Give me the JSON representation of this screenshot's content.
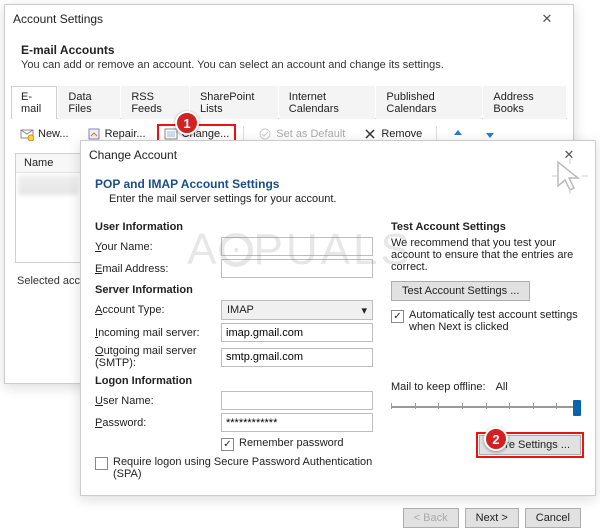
{
  "win1": {
    "title": "Account Settings",
    "header_title": "E-mail Accounts",
    "header_sub": "You can add or remove an account. You can select an account and change its settings.",
    "tabs": [
      "E-mail",
      "Data Files",
      "RSS Feeds",
      "SharePoint Lists",
      "Internet Calendars",
      "Published Calendars",
      "Address Books"
    ],
    "toolbar": {
      "new": "New...",
      "repair": "Repair...",
      "change": "Change...",
      "setdefault": "Set as Default",
      "remove": "Remove"
    },
    "list_header": "Name",
    "selected_label": "Selected account de"
  },
  "win2": {
    "title": "Change Account",
    "section_title": "POP and IMAP Account Settings",
    "section_sub": "Enter the mail server settings for your account.",
    "groups": {
      "user": "User Information",
      "server": "Server Information",
      "logon": "Logon Information"
    },
    "labels": {
      "yourname": "Your Name:",
      "email": "Email Address:",
      "accttype": "Account Type:",
      "incoming": "Incoming mail server:",
      "outgoing": "Outgoing mail server (SMTP):",
      "username": "User Name:",
      "password": "Password:"
    },
    "values": {
      "yourname": "",
      "email": "",
      "accttype": "IMAP",
      "incoming": "imap.gmail.com",
      "outgoing": "smtp.gmail.com",
      "username": "",
      "password": "************"
    },
    "remember_pw": "Remember password",
    "remember_pw_checked": true,
    "spa": "Require logon using Secure Password Authentication (SPA)",
    "spa_checked": false,
    "test": {
      "title": "Test Account Settings",
      "desc": "We recommend that you test your account to ensure that the entries are correct.",
      "button": "Test Account Settings ...",
      "auto": "Automatically test account settings when Next is clicked",
      "auto_checked": true
    },
    "offline": {
      "label": "Mail to keep offline:",
      "value": "All"
    },
    "more": "More Settings ...",
    "nav": {
      "back": "< Back",
      "next": "Next >",
      "cancel": "Cancel"
    }
  },
  "callouts": {
    "c1": "1",
    "c2": "2"
  },
  "watermark": {
    "pre": "A",
    "post": "PUALS"
  }
}
